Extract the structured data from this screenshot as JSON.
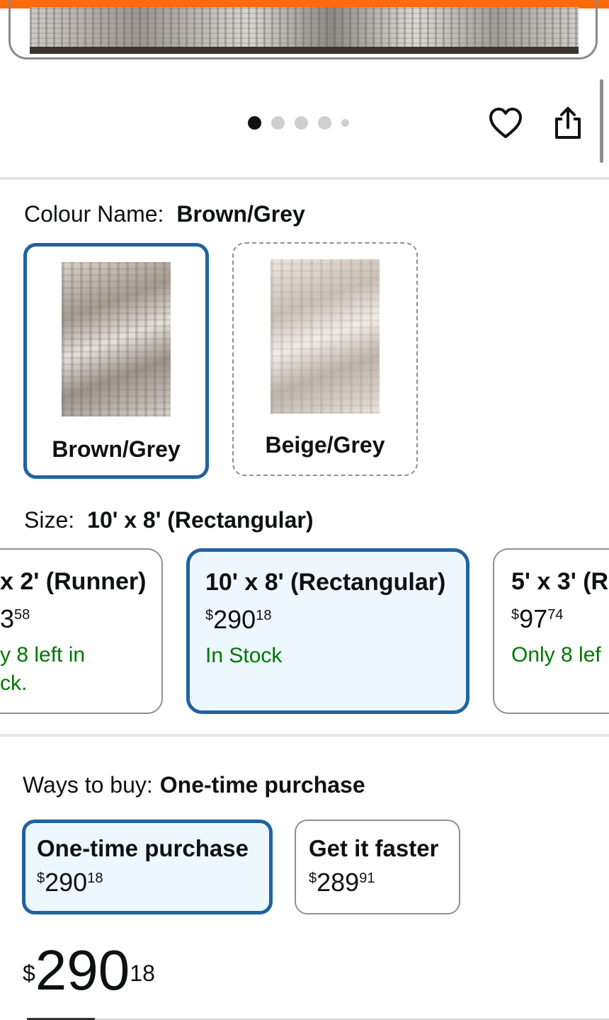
{
  "product": {
    "carousel": {
      "total_images": 5,
      "active_index": 0
    },
    "colour": {
      "label": "Colour Name:",
      "selected": "Brown/Grey",
      "options": [
        {
          "name": "Brown/Grey",
          "state": "selected"
        },
        {
          "name": "Beige/Grey",
          "state": "unavailable"
        }
      ]
    },
    "size": {
      "label": "Size:",
      "selected": "10' x 8' (Rectangular)",
      "options": [
        {
          "title": "x 2' (Runner)",
          "price_dollars": "58",
          "price_symbol": "",
          "price_cents": "",
          "stock_line1": "y 8 left in",
          "stock_line2": "ck."
        },
        {
          "title": "10' x 8' (Rectangular)",
          "price_symbol": "$",
          "price_dollars": "290",
          "price_cents": "18",
          "stock_line1": "In Stock",
          "stock_line2": ""
        },
        {
          "title": "5' x 3' (R",
          "price_symbol": "$",
          "price_dollars": "97",
          "price_cents": "74",
          "stock_line1": "Only 8 lef",
          "stock_line2": ""
        }
      ]
    },
    "ways_to_buy": {
      "label": "Ways to buy:",
      "selected": "One-time purchase",
      "options": [
        {
          "title": "One-time purchase",
          "symbol": "$",
          "dollars": "290",
          "cents": "18"
        },
        {
          "title": "Get it faster",
          "symbol": "$",
          "dollars": "289",
          "cents": "91"
        }
      ]
    },
    "price": {
      "symbol": "$",
      "dollars": "290",
      "cents": "18"
    }
  },
  "colors": {
    "accent_orange": "#ff6a0a",
    "selected_border": "#2162a1",
    "selected_bg": "#edf7fe",
    "in_stock": "#007600"
  },
  "icons": [
    "heart-icon",
    "share-icon"
  ]
}
